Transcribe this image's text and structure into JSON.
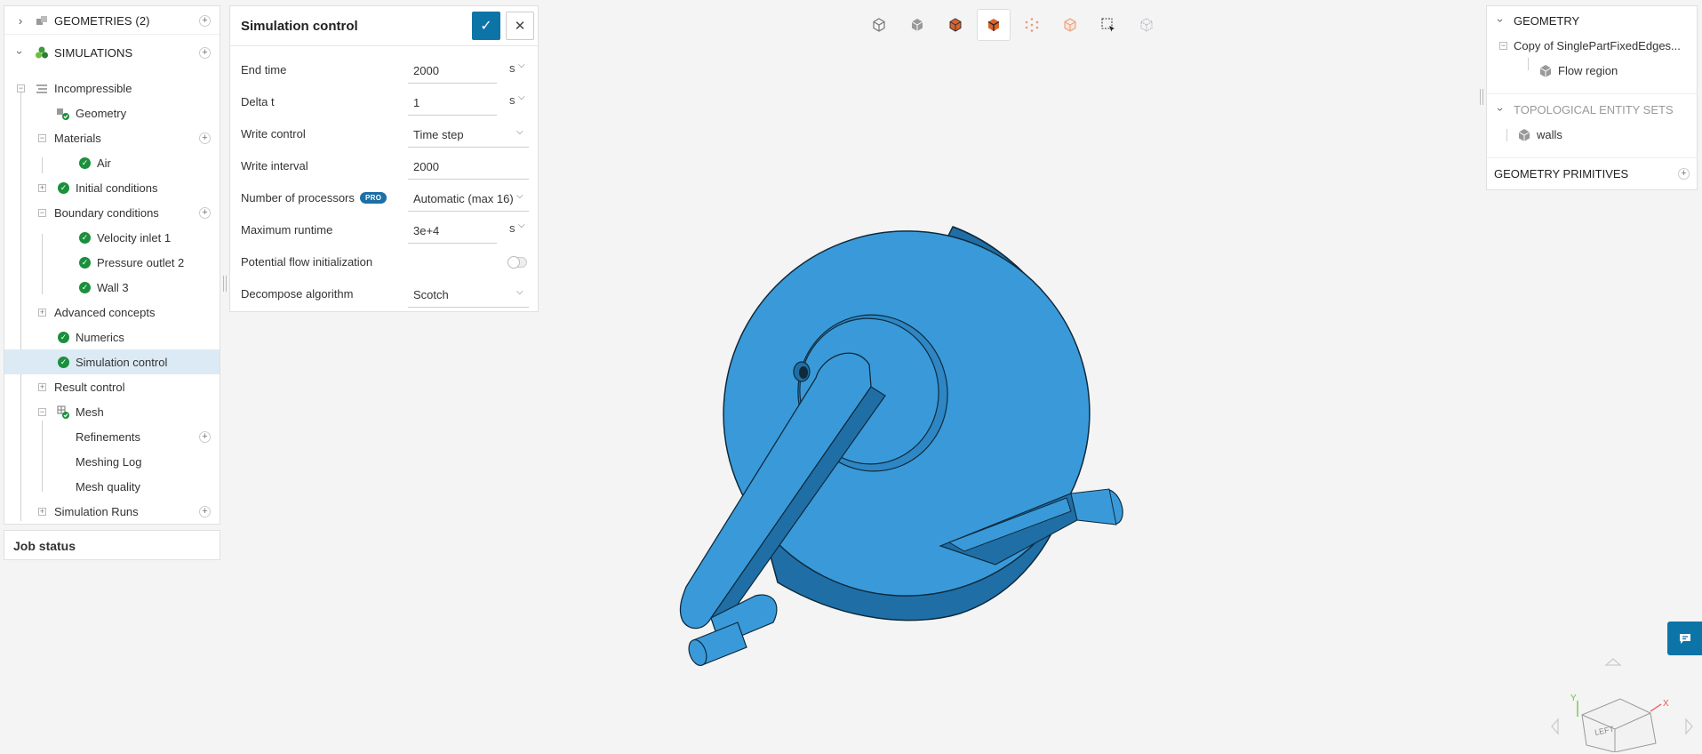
{
  "left_tree": {
    "geometries_label": "GEOMETRIES (2)",
    "simulations_label": "SIMULATIONS",
    "items": [
      {
        "label": "Incompressible"
      },
      {
        "label": "Geometry"
      },
      {
        "label": "Materials"
      },
      {
        "label": "Air"
      },
      {
        "label": "Initial conditions"
      },
      {
        "label": "Boundary conditions"
      },
      {
        "label": "Velocity inlet 1"
      },
      {
        "label": "Pressure outlet 2"
      },
      {
        "label": "Wall 3"
      },
      {
        "label": "Advanced concepts"
      },
      {
        "label": "Numerics"
      },
      {
        "label": "Simulation control"
      },
      {
        "label": "Result control"
      },
      {
        "label": "Mesh"
      },
      {
        "label": "Refinements"
      },
      {
        "label": "Meshing Log"
      },
      {
        "label": "Mesh quality"
      },
      {
        "label": "Simulation Runs"
      }
    ],
    "selected": "Simulation control"
  },
  "job_status": {
    "title": "Job status"
  },
  "dialog": {
    "title": "Simulation control",
    "confirm_icon": "check-icon",
    "close_icon": "close-icon",
    "fields": {
      "end_time": {
        "label": "End time",
        "value": "2000",
        "unit": "s"
      },
      "delta_t": {
        "label": "Delta t",
        "value": "1",
        "unit": "s"
      },
      "write_control": {
        "label": "Write control",
        "value": "Time step"
      },
      "write_interval": {
        "label": "Write interval",
        "value": "2000"
      },
      "num_processors": {
        "label": "Number of processors",
        "badge": "PRO",
        "value": "Automatic (max 16)"
      },
      "max_runtime": {
        "label": "Maximum runtime",
        "value": "3e+4",
        "unit": "s"
      },
      "potential_flow": {
        "label": "Potential flow initialization",
        "enabled": false
      },
      "decompose": {
        "label": "Decompose algorithm",
        "value": "Scotch"
      }
    }
  },
  "toolbar": {
    "buttons": [
      "wireframe-view-icon",
      "solid-view-icon",
      "surfaces-edges-view-icon",
      "surfaces-view-icon",
      "points-view-icon",
      "transparent-view-icon",
      "box-select-icon",
      "hide-selection-icon"
    ],
    "active_index": 3
  },
  "right_tree": {
    "geometry_header": "GEOMETRY",
    "geometry_item": "Copy of SinglePartFixedEdges...",
    "flow_region": "Flow region",
    "topo_header": "TOPOLOGICAL ENTITY SETS",
    "walls": "walls",
    "primitives_header": "GEOMETRY PRIMITIVES"
  },
  "viewcube": {
    "face_label": "LEFT",
    "axis_x": "X",
    "axis_y": "Y"
  },
  "colors": {
    "accent": "#0d74a8",
    "model_face": "#3a9ad9",
    "model_side": "#1f6fa6",
    "check_green": "#1a8f3c"
  }
}
